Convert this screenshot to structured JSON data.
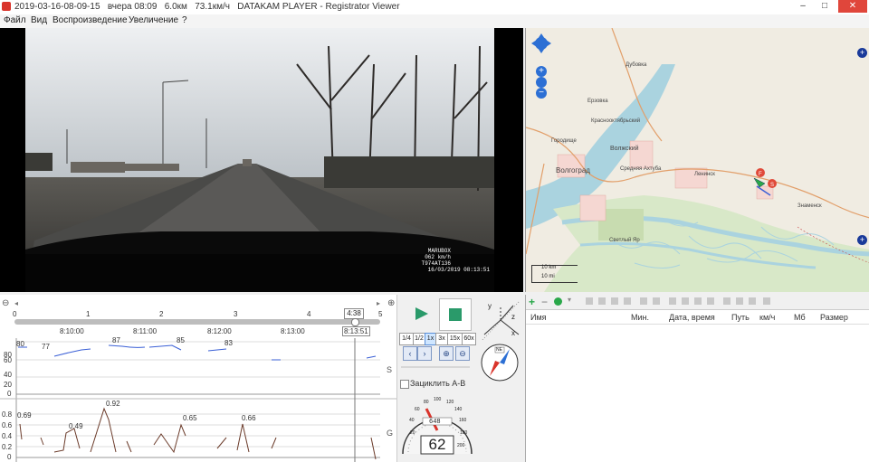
{
  "window": {
    "title": "2019-03-16-08-09-15   вчера 08:09   6.0км   73.1км/ч   DATAKAM PLAYER - Registrator Viewer",
    "minimize": "–",
    "maximize": "□",
    "close": "✕"
  },
  "menu": {
    "items": [
      "Файл",
      "Вид",
      "Воспроизведение",
      "Увеличение",
      "?"
    ]
  },
  "video": {
    "osd": {
      "brand": "MARUBOX",
      "speed": "062 km/h",
      "plate": "T974AT136",
      "datetime": "16/03/2019 08:13:51"
    }
  },
  "map": {
    "labels": [
      "Дубовка",
      "Ерзовка",
      "Краснооктябрьский",
      "Городище",
      "Волжский",
      "Волгоград",
      "Средняя Ахтуба",
      "Ленинск",
      "Знаменск",
      "Светлый Яр"
    ],
    "markers": [
      "F",
      "S"
    ],
    "scale": [
      "10 km",
      "10 mi"
    ],
    "zoom_in": "+",
    "zoom_out": "−",
    "expand": "+"
  },
  "timeline": {
    "minute_ticks": [
      "0",
      "1",
      "2",
      "3",
      "4",
      "5"
    ],
    "position_label": "4:38",
    "time_ticks": [
      "8:10:00",
      "8:11:00",
      "8:12:00",
      "8:13:00"
    ],
    "current_time": "8:13:51",
    "zoom_out_icon": "magnifier-minus",
    "zoom_in_icon": "magnifier-plus"
  },
  "graphs": {
    "speed": {
      "axis_label": "S",
      "ticks": [
        "80",
        "60",
        "40",
        "20",
        "0"
      ],
      "annotations": [
        "80",
        "77",
        "87",
        "85",
        "83"
      ]
    },
    "g": {
      "axis_label": "G",
      "ticks": [
        "0.8",
        "0.6",
        "0.4",
        "0.2",
        "0"
      ],
      "annotations": [
        "0.69",
        "0.49",
        "0.92",
        "0.65",
        "0.66"
      ]
    }
  },
  "controls": {
    "play_icon": "play-icon",
    "stop_icon": "stop-icon",
    "speeds": [
      "1/4",
      "1/2",
      "1x",
      "3x",
      "15x",
      "60x"
    ],
    "active_speed": "1x",
    "loop_label": "Зациклить A-B",
    "axes": [
      "y",
      "z",
      "x"
    ],
    "compass_heading": "NE",
    "speedometer_value": "62",
    "odometer": "648",
    "speedometer_scale": [
      "20",
      "40",
      "60",
      "80",
      "100",
      "120",
      "140",
      "160",
      "180",
      "200"
    ]
  },
  "trips": {
    "columns": [
      "Имя",
      "Мин.",
      "Дата, время",
      "Путь",
      "км/ч",
      "Мб",
      "Размер"
    ]
  },
  "colors": {
    "accent": "#2c6fd4",
    "play_green": "#2a9a6a",
    "speed_line": "#3a5fd6",
    "g_line": "#6b3b2a",
    "marker_red": "#e04a3a",
    "marker_green": "#2aa84a",
    "water": "#aad3df"
  }
}
